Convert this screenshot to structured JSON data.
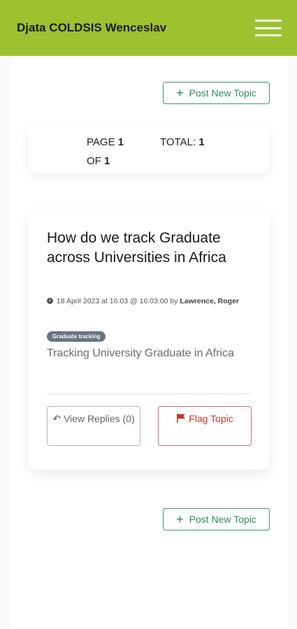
{
  "header": {
    "title": "Djata COLDSIS Wenceslav",
    "menu_icon": "hamburger-icon"
  },
  "actions": {
    "post_new_topic_label": "Post New Topic"
  },
  "pagination": {
    "page_label": "PAGE",
    "page_number": "1",
    "of_label": "OF",
    "of_number": "1",
    "total_label": "TOTAL:",
    "total_number": "1"
  },
  "topic": {
    "title": "How do we track Graduate across Universities in Africa",
    "date": "18 April 2023 at 16:03 @ 16:03:00",
    "by_label": "by",
    "author": "Lawrence, Roger",
    "tag": "Graduate tracking",
    "description": "Tracking University Graduate in Africa",
    "view_replies_label": "View Replies (0)",
    "flag_label": "Flag Topic"
  },
  "colors": {
    "header_bg": "#9dc230",
    "accent_green": "#2f8a5c",
    "flag_red": "#c0392b",
    "tag_bg": "#6c757d"
  }
}
